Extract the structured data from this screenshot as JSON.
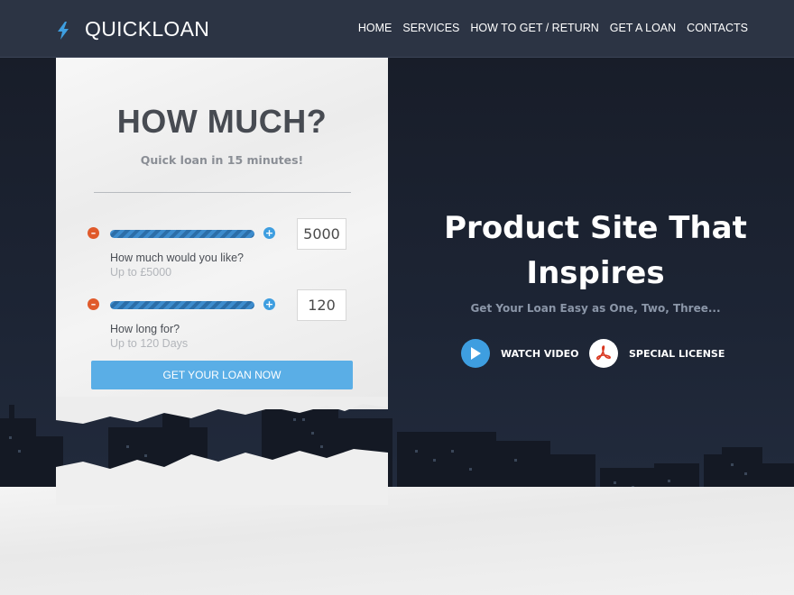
{
  "header": {
    "logo_text": "QUICKLOAN",
    "nav": [
      "HOME",
      "SERVICES",
      "HOW TO GET / RETURN",
      "GET A LOAN",
      "CONTACTS"
    ]
  },
  "card": {
    "title": "HOW MUCH?",
    "subtitle": "Quick loan in 15 minutes!",
    "amount": {
      "value": "5000",
      "label": "How much would you like?",
      "hint": "Up to £5000"
    },
    "duration": {
      "value": "120",
      "label": "How long for?",
      "hint": "Up to 120 Days"
    },
    "cta_label": "GET YOUR LOAN NOW"
  },
  "hero": {
    "title_line1": "Product Site That",
    "title_line2": "Inspires",
    "subtitle": "Get Your Loan Easy as One, Two, Three...",
    "watch_video_label": "WATCH VIDEO",
    "special_license_label": "SPECIAL LICENSE"
  },
  "colors": {
    "accent_blue": "#5aaee6",
    "minus_orange": "#e05a2b",
    "plus_blue": "#3e9ee0",
    "header_bg": "#2c3444"
  },
  "icons": [
    "lightning-icon",
    "minus-icon",
    "plus-icon",
    "play-icon",
    "pdf-icon"
  ]
}
